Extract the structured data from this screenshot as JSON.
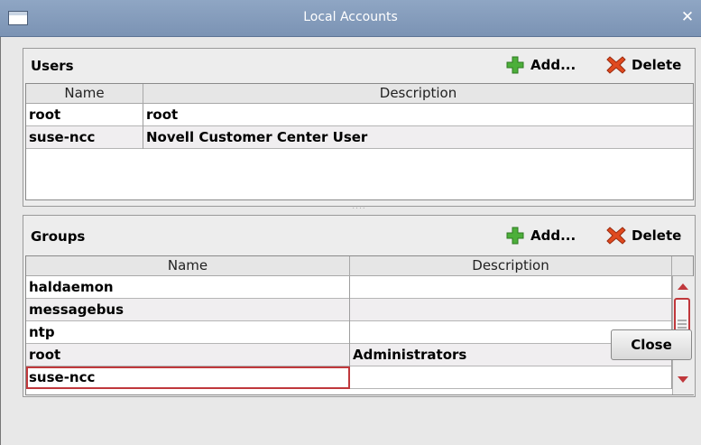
{
  "window": {
    "title": "Local Accounts"
  },
  "users": {
    "title": "Users",
    "add_label": "Add...",
    "delete_label": "Delete",
    "columns": [
      "Name",
      "Description"
    ],
    "rows": [
      {
        "name": "root",
        "description": "root"
      },
      {
        "name": "suse-ncc",
        "description": "Novell Customer Center User"
      }
    ]
  },
  "splitter": "....",
  "groups": {
    "title": "Groups",
    "add_label": "Add...",
    "delete_label": "Delete",
    "columns": [
      "Name",
      "Description"
    ],
    "rows": [
      {
        "name": "haldaemon",
        "description": ""
      },
      {
        "name": "messagebus",
        "description": ""
      },
      {
        "name": "ntp",
        "description": ""
      },
      {
        "name": "root",
        "description": "Administrators"
      },
      {
        "name": "suse-ncc",
        "description": ""
      }
    ]
  },
  "close_label": "Close",
  "colors": {
    "titlebar": "#8fa6c4",
    "accent": "#c0383c",
    "add_icon": "#4caf3a",
    "delete_icon": "#e04a1f"
  },
  "icons": {
    "add": "plus-icon",
    "delete": "x-icon"
  }
}
